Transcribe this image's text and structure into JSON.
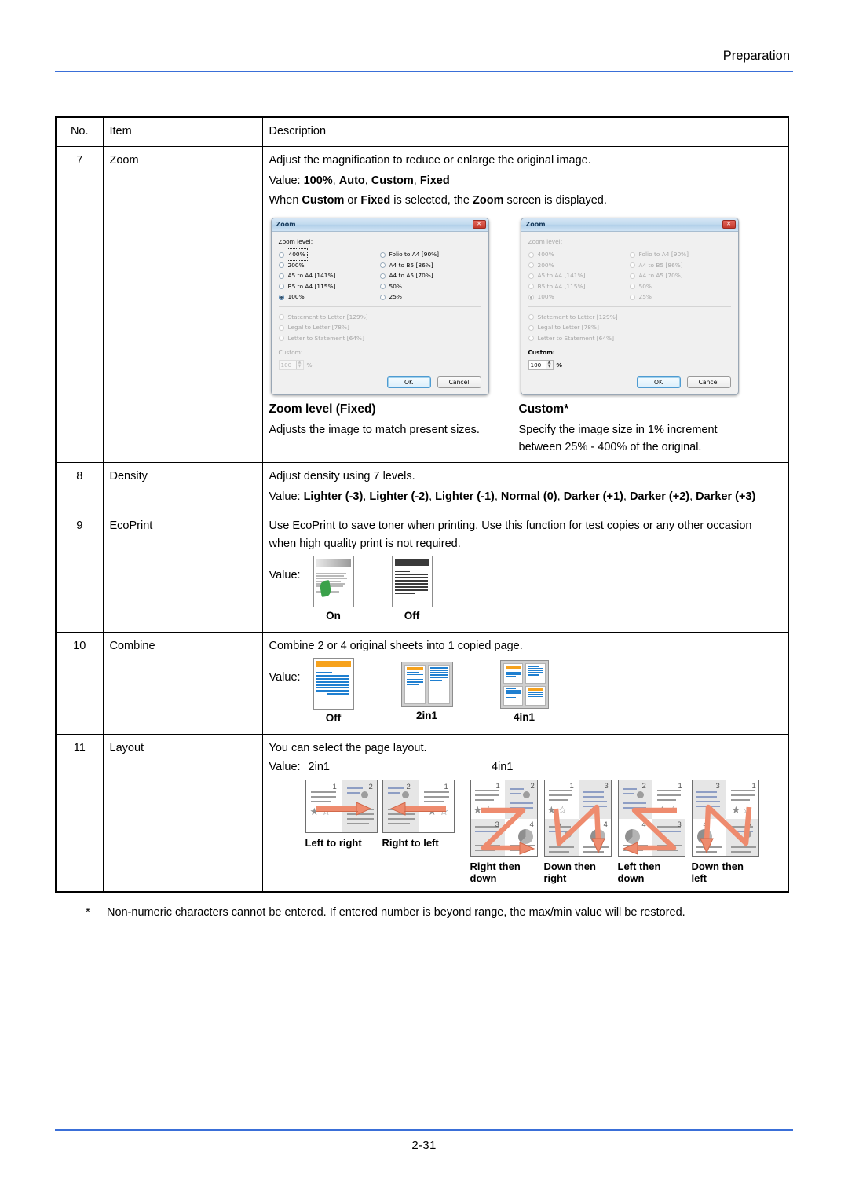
{
  "header": {
    "chapter": "Preparation"
  },
  "footer": {
    "page_number": "2-31"
  },
  "table": {
    "headers": {
      "no": "No.",
      "item": "Item",
      "description": "Description"
    },
    "rows": [
      {
        "no": "7",
        "item": "Zoom",
        "desc_line1": "Adjust the magnification to reduce or enlarge the original image.",
        "value_prefix": "Value:",
        "values": [
          "100%",
          "Auto",
          "Custom",
          "Fixed"
        ],
        "desc_line3_a": "When ",
        "desc_line3_b": "Custom",
        "desc_line3_c": " or ",
        "desc_line3_d": "Fixed",
        "desc_line3_e": " is selected, the ",
        "desc_line3_f": "Zoom",
        "desc_line3_g": " screen is displayed.",
        "captions": [
          {
            "title": "Zoom level (Fixed)",
            "text": "Adjusts the image to match present sizes."
          },
          {
            "title": "Custom*",
            "text": "Specify the image size in 1% increment between 25% - 400% of the original."
          }
        ]
      },
      {
        "no": "8",
        "item": "Density",
        "desc_line1": "Adjust density using 7 levels.",
        "value_prefix": "Value:",
        "values": [
          "Lighter (-3)",
          "Lighter (-2)",
          "Lighter (-1)",
          "Normal (0)",
          "Darker (+1)",
          "Darker (+2)",
          "Darker (+3)"
        ]
      },
      {
        "no": "9",
        "item": "EcoPrint",
        "desc_line1": "Use EcoPrint to save toner when printing. Use this function for test copies or any other occasion when high quality print is not required.",
        "value_prefix": "Value:",
        "icons": [
          {
            "caption": "On"
          },
          {
            "caption": "Off"
          }
        ]
      },
      {
        "no": "10",
        "item": "Combine",
        "desc_line1": "Combine 2 or 4 original sheets into 1 copied page.",
        "value_prefix": "Value:",
        "icons": [
          {
            "caption": "Off"
          },
          {
            "caption": "2in1"
          },
          {
            "caption": "4in1"
          }
        ]
      },
      {
        "no": "11",
        "item": "Layout",
        "desc_line1": "You can select the page layout.",
        "value_prefix": "Value:",
        "group_2in1_label": "2in1",
        "group_4in1_label": "4in1",
        "layouts_2in1": [
          {
            "caption": "Left to right"
          },
          {
            "caption": "Right to left"
          }
        ],
        "layouts_4in1": [
          {
            "caption_line1": "Right then",
            "caption_line2": "down"
          },
          {
            "caption_line1": "Down then",
            "caption_line2": "right"
          },
          {
            "caption_line1": "Left then",
            "caption_line2": "down"
          },
          {
            "caption_line1": "Down then",
            "caption_line2": "left"
          }
        ]
      }
    ]
  },
  "zoom_dialog_fixed": {
    "title": "Zoom",
    "close_glyph": "✕",
    "group_label": "Zoom level:",
    "options_left": [
      "400%",
      "200%",
      "A5 to A4 [141%]",
      "B5 to A4 [115%]",
      "100%"
    ],
    "options_right": [
      "Folio to A4 [90%]",
      "A4 to B5 [86%]",
      "A4 to A5 [70%]",
      "50%",
      "25%"
    ],
    "options_lower": [
      "Statement to Letter [129%]",
      "Legal to Letter [78%]",
      "Letter to Statement [64%]"
    ],
    "selected_option": "100%",
    "focused_option": "400%",
    "custom_label": "Custom:",
    "custom_value": "100",
    "percent_symbol": "%",
    "ok_label": "OK",
    "cancel_label": "Cancel"
  },
  "zoom_dialog_custom": {
    "title": "Zoom",
    "close_glyph": "✕",
    "group_label": "Zoom level:",
    "options_left": [
      "400%",
      "200%",
      "A5 to A4 [141%]",
      "B5 to A4 [115%]",
      "100%"
    ],
    "options_right": [
      "Folio to A4 [90%]",
      "A4 to B5 [86%]",
      "A4 to A5 [70%]",
      "50%",
      "25%"
    ],
    "options_lower": [
      "Statement to Letter [129%]",
      "Legal to Letter [78%]",
      "Letter to Statement [64%]"
    ],
    "selected_option": "100%",
    "custom_label": "Custom:",
    "custom_value": "100",
    "percent_symbol": "%",
    "ok_label": "OK",
    "cancel_label": "Cancel"
  },
  "footnote": {
    "marker": "*",
    "text": "Non-numeric characters cannot be entered. If entered number is beyond range, the max/min value will be restored."
  },
  "colors": {
    "rule_blue": "#3a6fd8",
    "accent_orange": "#f6a21d",
    "accent_blue": "#1f7fd0",
    "leaf_green": "#3aa14a",
    "arrow_salmon": "#ee8b6e"
  }
}
